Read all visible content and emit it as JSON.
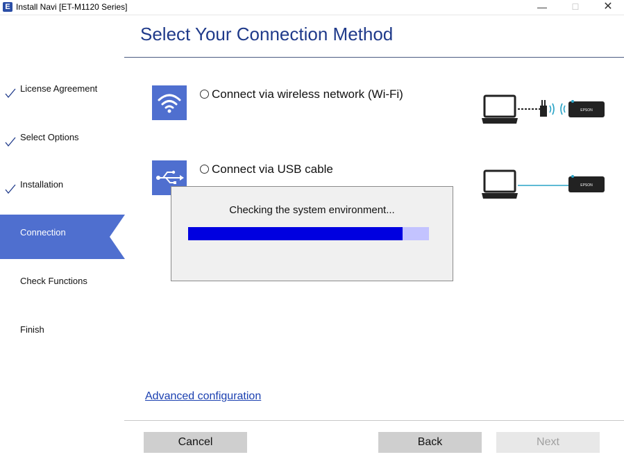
{
  "window": {
    "title": "Install Navi [ET-M1120 Series]",
    "app_icon_letter": "E",
    "minimize_glyph": "—",
    "maximize_glyph": "☐",
    "close_glyph": "✕"
  },
  "sidebar": {
    "items": [
      {
        "label": "License Agreement",
        "state": "done"
      },
      {
        "label": "Select Options",
        "state": "done"
      },
      {
        "label": "Installation",
        "state": "done"
      },
      {
        "label": "Connection",
        "state": "active"
      },
      {
        "label": "Check Functions",
        "state": "pending"
      },
      {
        "label": "Finish",
        "state": "pending"
      }
    ]
  },
  "header": {
    "title": "Select Your Connection Method"
  },
  "options": [
    {
      "label": "Connect via wireless network (Wi-Fi)",
      "icon": "wifi-icon",
      "selected": false
    },
    {
      "label": "Connect via USB cable",
      "icon": "usb-icon",
      "selected": false
    }
  ],
  "illustrations": {
    "printer_brand": "EPSON"
  },
  "dialog": {
    "message": "Checking the system environment...",
    "progress": 0.89
  },
  "footer": {
    "advanced_link": "Advanced configuration",
    "cancel_label": "Cancel",
    "back_label": "Back",
    "next_label": "Next",
    "next_enabled": false
  },
  "colors": {
    "accent": "#4f6fcf",
    "title": "#1f3a8a",
    "progress_fill": "#0000e0",
    "progress_track": "#c3c3ff"
  }
}
